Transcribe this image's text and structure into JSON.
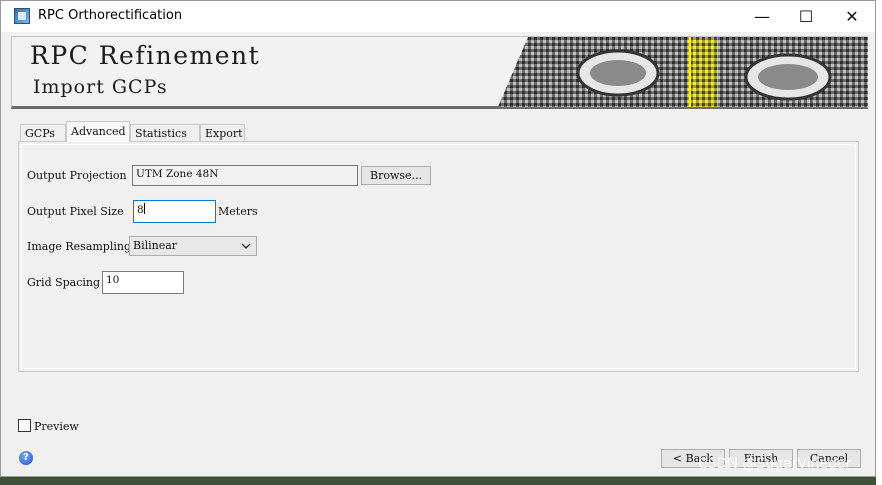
{
  "window": {
    "title": "RPC Orthorectification",
    "controls": {
      "minimize": "—",
      "maximize": "☐",
      "close": "✕"
    }
  },
  "header": {
    "title": "RPC Refinement",
    "subtitle": "Import GCPs"
  },
  "tabs": [
    {
      "label": "GCPs",
      "active": false
    },
    {
      "label": "Advanced",
      "active": true
    },
    {
      "label": "Statistics",
      "active": false
    },
    {
      "label": "Export",
      "active": false
    }
  ],
  "form": {
    "output_projection": {
      "label": "Output Projection",
      "value": "UTM Zone 48N",
      "browse_label": "Browse..."
    },
    "output_pixel_size": {
      "label": "Output Pixel Size",
      "value": "8",
      "unit": "Meters"
    },
    "image_resampling": {
      "label": "Image Resampling",
      "selected": "Bilinear"
    },
    "grid_spacing": {
      "label": "Grid Spacing",
      "value": "10"
    }
  },
  "preview": {
    "label": "Preview",
    "checked": false
  },
  "footer": {
    "back_label": "< Back",
    "finish_label": "Finish",
    "cancel_label": "Cancel"
  },
  "watermark": "CSDN @SugarVinegar",
  "colors": {
    "accent_focus": "#0078d7",
    "banner_highlight": "#f2e83a"
  },
  "icons": [
    "app-icon",
    "help-icon",
    "chevron-down-icon"
  ]
}
